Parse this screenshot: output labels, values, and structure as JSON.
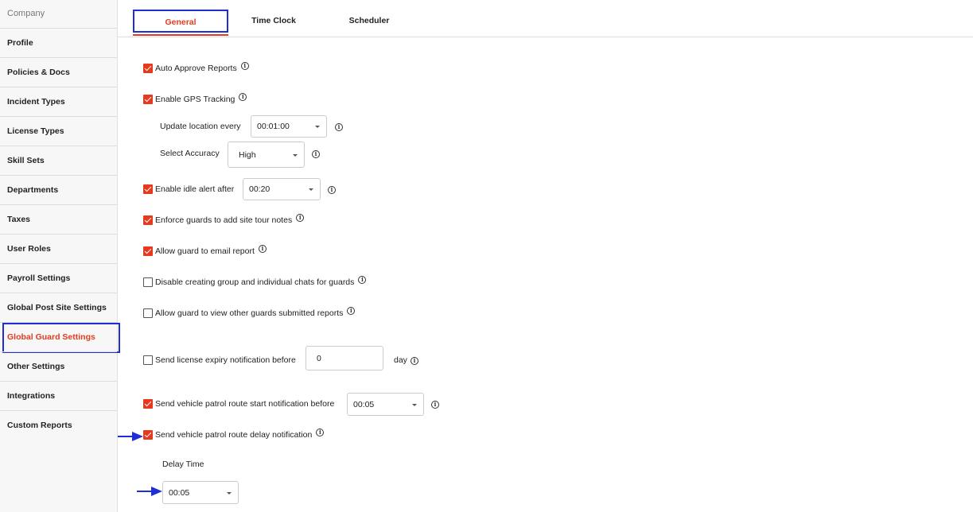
{
  "sidebar": {
    "heading": "Company",
    "items": [
      {
        "label": "Profile"
      },
      {
        "label": "Policies & Docs"
      },
      {
        "label": "Incident Types"
      },
      {
        "label": "License Types"
      },
      {
        "label": "Skill Sets"
      },
      {
        "label": "Departments"
      },
      {
        "label": "Taxes"
      },
      {
        "label": "User Roles"
      },
      {
        "label": "Payroll Settings"
      },
      {
        "label": "Global Post Site Settings"
      },
      {
        "label": "Global Guard Settings"
      },
      {
        "label": "Other Settings"
      },
      {
        "label": "Integrations"
      },
      {
        "label": "Custom Reports"
      }
    ],
    "active_index": 10
  },
  "tabs": [
    {
      "label": "General"
    },
    {
      "label": "Time Clock"
    },
    {
      "label": "Scheduler"
    }
  ],
  "settings": {
    "auto_approve": {
      "label": "Auto Approve Reports",
      "checked": true
    },
    "gps": {
      "label": "Enable GPS Tracking",
      "checked": true
    },
    "update_location": {
      "label": "Update location every",
      "value": "00:01:00"
    },
    "accuracy": {
      "label": "Select Accuracy",
      "value": "High"
    },
    "idle_alert": {
      "label": "Enable idle alert after",
      "checked": true,
      "value": "00:20"
    },
    "site_tour": {
      "label": "Enforce guards to add site tour notes",
      "checked": true
    },
    "email_report": {
      "label": "Allow guard to email report",
      "checked": true
    },
    "disable_chats": {
      "label": "Disable creating group and individual chats for guards",
      "checked": false
    },
    "view_reports": {
      "label": "Allow guard to view other guards submitted reports",
      "checked": false
    },
    "license_expiry": {
      "label": "Send license expiry notification before",
      "checked": false,
      "value": "0",
      "unit": "day"
    },
    "patrol_start": {
      "label": "Send vehicle patrol route start notification before",
      "checked": true,
      "value": "00:05"
    },
    "patrol_delay": {
      "label": "Send vehicle patrol route delay notification",
      "checked": true
    },
    "delay_time": {
      "label": "Delay Time",
      "value": "00:05"
    }
  },
  "colors": {
    "accent": "#e53a1e",
    "highlight": "#1f2fd4"
  }
}
